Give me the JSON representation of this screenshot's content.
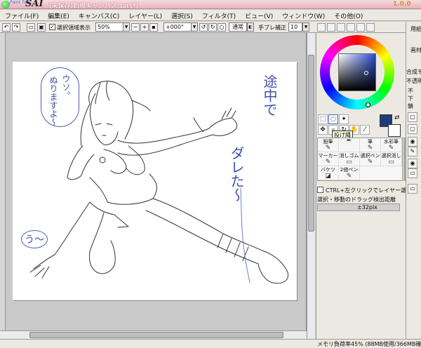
{
  "titlebar": {
    "app_name_small": "Paint Tool",
    "app_name": "SAI",
    "document_title": "(未保存)新規キャンバス.sai (*)",
    "version": "1.0.0"
  },
  "menu": [
    "ファイル(F)",
    "編集(E)",
    "キャンバス(C)",
    "レイヤー(L)",
    "選択(S)",
    "フィルタ(T)",
    "ビュー(V)",
    "ウィンドウ(W)",
    "その他(O)"
  ],
  "toolbar": {
    "show_selection_label": "選択領域表示",
    "show_selection_checked": true,
    "zoom": "50%",
    "rotation": "+000°",
    "blend_mode": "通常",
    "stabilizer_label": "手ブレ補正",
    "stabilizer_value": "10"
  },
  "canvas": {
    "annotations": [
      "ウソ。",
      "ぬりますよ〜",
      "途中で",
      "ダレた〜",
      "う〜"
    ]
  },
  "tools": {
    "tooltip": "投げ縄",
    "brushes": [
      {
        "label": "鉛筆",
        "icon": "pencil-icon"
      },
      {
        "label": "",
        "icon": "lasso-icon"
      },
      {
        "label": "筆",
        "icon": "brush-icon"
      },
      {
        "label": "水彩筆",
        "icon": "watercolor-icon"
      },
      {
        "label": "マーカー",
        "icon": "marker-icon"
      },
      {
        "label": "消しゴム",
        "icon": "eraser-icon"
      },
      {
        "label": "選択ペン",
        "icon": "select-pen-icon"
      },
      {
        "label": "選択消し",
        "icon": "select-erase-icon"
      },
      {
        "label": "バケツ",
        "icon": "bucket-icon"
      },
      {
        "label": "2値ペン",
        "icon": "binary-pen-icon"
      }
    ],
    "ctrl_option": "CTRL+左クリックでレイヤー選択",
    "drag_label": "選択・移動のドラッグ検出距離",
    "drag_value": "±32pix"
  },
  "colors": {
    "foreground": "#1f3c7a",
    "background": "#ffffff"
  },
  "far_right": {
    "labels": [
      "用紙",
      "画材",
      "合成モ",
      "不透明",
      "不",
      "下",
      "鎖"
    ]
  },
  "status": {
    "memory": "メモリ負荷率45% (88MB使用/366MB確保)"
  }
}
